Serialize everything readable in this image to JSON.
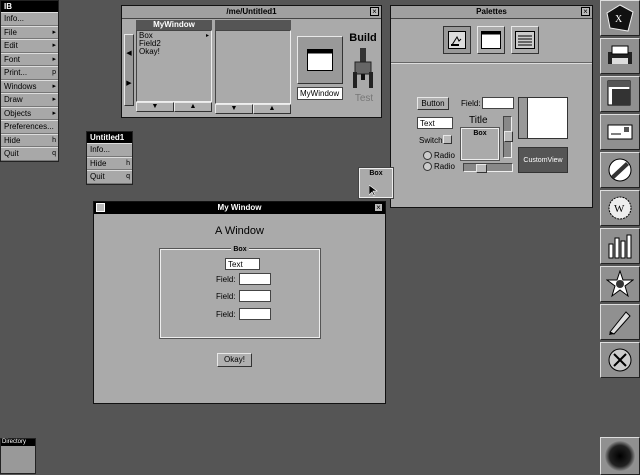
{
  "app_menu": {
    "title": "IB",
    "items": [
      {
        "label": "Info...",
        "key": ""
      },
      {
        "label": "File",
        "key": "▸"
      },
      {
        "label": "Edit",
        "key": "▸"
      },
      {
        "label": "Font",
        "key": "▸"
      },
      {
        "label": "Print...",
        "key": "p"
      },
      {
        "label": "Windows",
        "key": "▸"
      },
      {
        "label": "Draw",
        "key": "▸"
      },
      {
        "label": "Objects",
        "key": "▸"
      },
      {
        "label": "Preferences...",
        "key": ""
      },
      {
        "label": "Hide",
        "key": "h"
      },
      {
        "label": "Quit",
        "key": "q"
      }
    ]
  },
  "doc_menu": {
    "title": "Untitled1",
    "items": [
      {
        "label": "Info...",
        "key": ""
      },
      {
        "label": "Hide",
        "key": "h"
      },
      {
        "label": "Quit",
        "key": "q"
      }
    ]
  },
  "file_window": {
    "title": "/me/Untitled1",
    "browser_header": "MyWindow",
    "browser_items": [
      "Box",
      "Field2",
      "Okay!"
    ],
    "instance_label": "MyWindow",
    "build_label": "Build",
    "test_label": "Test"
  },
  "palettes": {
    "title": "Palettes",
    "button_label": "Button",
    "field_label": "Field:",
    "text_value": "Text",
    "title_label": "Title",
    "box_label": "Box",
    "switch_label": "Switch",
    "radio_labels": [
      "Radio",
      "Radio"
    ],
    "custom_view_label": "CustomView"
  },
  "drag_box": {
    "label": "Box"
  },
  "my_window": {
    "title": "My Window",
    "heading": "A Window",
    "box_label": "Box",
    "text_value": "Text",
    "field_labels": [
      "Field:",
      "Field:",
      "Field:"
    ],
    "okay_label": "Okay!"
  },
  "directory": {
    "label": "Directory"
  },
  "dock": {
    "icons": [
      "nextstep-icon",
      "printer-icon",
      "preferences-icon",
      "mail-icon",
      "draw-icon",
      "webster-icon",
      "chart-icon",
      "interface-builder-icon",
      "edit-icon",
      "recycler-icon",
      "black-hole-icon"
    ]
  }
}
